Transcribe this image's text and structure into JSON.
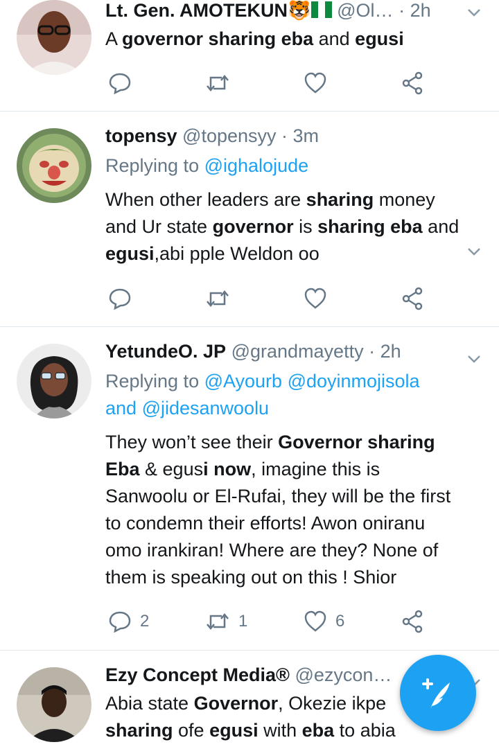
{
  "tweets": [
    {
      "name": "Lt. Gen. AMOTEKUN",
      "emoji": "🐯",
      "handle": "@Ol…",
      "time": "· 2h",
      "body": [
        {
          "t": "A ",
          "b": false
        },
        {
          "t": "governor sharing eba",
          "b": true
        },
        {
          "t": " and ",
          "b": false
        },
        {
          "t": "egusi",
          "b": true
        }
      ],
      "replies": "",
      "retweets": "",
      "likes": ""
    },
    {
      "name": "topensy",
      "handle": "@topensyy",
      "time": "· 3m",
      "replying_prefix": "Replying to ",
      "replying_to": "@ighalojude",
      "body_lines": [
        [
          {
            "t": "When other leaders are ",
            "b": false
          },
          {
            "t": "sharing",
            "b": true
          },
          {
            "t": " money",
            "b": false
          }
        ],
        [
          {
            "t": "and Ur state ",
            "b": false
          },
          {
            "t": "governor",
            "b": true
          },
          {
            "t": " is ",
            "b": false
          },
          {
            "t": "sharing eba",
            "b": true
          },
          {
            "t": " and",
            "b": false
          }
        ],
        [
          {
            "t": "egusi",
            "b": true
          },
          {
            "t": ",abi pple Weldon oo",
            "b": false
          }
        ]
      ],
      "replies": "",
      "retweets": "",
      "likes": ""
    },
    {
      "name": "YetundeO. JP",
      "handle": "@grandmayetty",
      "time": "· 2h",
      "replying_prefix": "Replying to ",
      "replying_to_line1": "@Ayourb @doyinmojisola",
      "replying_and": "and ",
      "replying_to_line2": "@jidesanwoolu",
      "body_lines": [
        [
          {
            "t": "They won’t see their ",
            "b": false
          },
          {
            "t": "Governor sharing",
            "b": true
          }
        ],
        [
          {
            "t": "Eba",
            "b": true
          },
          {
            "t": " & egus",
            "b": false
          },
          {
            "t": "i now",
            "b": true
          },
          {
            "t": ", imagine this is",
            "b": false
          }
        ],
        [
          {
            "t": "Sanwoolu or El-Rufai, they will be the first",
            "b": false
          }
        ],
        [
          {
            "t": "to condemn their efforts! Awon oniranu",
            "b": false
          }
        ],
        [
          {
            "t": "omo irankiran! Where are they? None of",
            "b": false
          }
        ],
        [
          {
            "t": "them is speaking out on this !  Shior",
            "b": false
          }
        ]
      ],
      "replies": "2",
      "retweets": "1",
      "likes": "6"
    },
    {
      "name": "Ezy Concept Media®",
      "handle": "@ezycon…",
      "body_lines": [
        [
          {
            "t": "Abia state ",
            "b": false
          },
          {
            "t": "Governor",
            "b": true
          },
          {
            "t": ", Okezie ikpe",
            "b": false
          }
        ],
        [
          {
            "t": "sharing",
            "b": true
          },
          {
            "t": " ofe ",
            "b": false
          },
          {
            "t": "egusi",
            "b": true
          },
          {
            "t": " with ",
            "b": false
          },
          {
            "t": "eba",
            "b": true
          },
          {
            "t": " to abia",
            "b": false
          }
        ]
      ]
    }
  ],
  "colors": {
    "link": "#1da1f2",
    "muted": "#657786",
    "fab": "#1da1f2"
  },
  "icons": [
    "reply-icon",
    "retweet-icon",
    "like-icon",
    "share-icon",
    "chevron-down-icon",
    "compose-icon"
  ]
}
